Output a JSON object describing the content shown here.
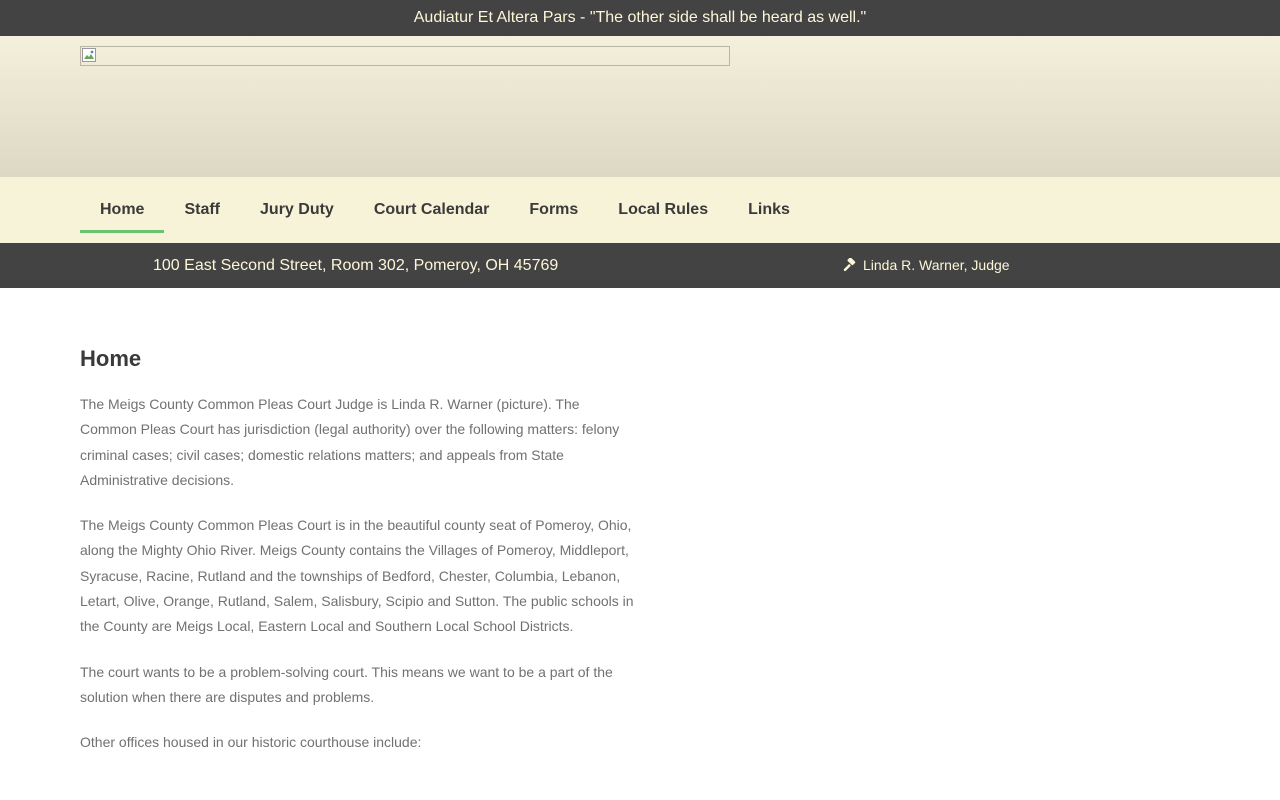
{
  "topbar": {
    "motto": "Audiatur Et Altera Pars - \"The other side shall be heard as well.\""
  },
  "nav": {
    "items": [
      {
        "label": "Home"
      },
      {
        "label": "Staff"
      },
      {
        "label": "Jury Duty"
      },
      {
        "label": "Court Calendar"
      },
      {
        "label": "Forms"
      },
      {
        "label": "Local Rules"
      },
      {
        "label": "Links"
      }
    ],
    "active": "Home"
  },
  "infobar": {
    "address": "100 East Second Street, Room 302, Pomeroy, OH 45769",
    "judge": "Linda R. Warner, Judge",
    "judge_icon": "gavel-icon"
  },
  "main": {
    "title": "Home",
    "paragraphs": [
      "The Meigs County Common Pleas Court Judge is Linda R. Warner (picture). The Common Pleas Court has jurisdiction (legal authority) over the following matters: felony criminal cases; civil cases; domestic relations matters; and appeals from State Administrative decisions.",
      "The Meigs County Common Pleas Court is in the beautiful county seat of Pomeroy, Ohio, along the Mighty Ohio River. Meigs County contains the Villages of Pomeroy, Middleport, Syracuse, Racine, Rutland and the townships of Bedford, Chester, Columbia, Lebanon, Letart, Olive, Orange, Rutland, Salem, Salisbury, Scipio and Sutton. The public schools in the County are Meigs Local, Eastern Local and Southern Local School Districts.",
      "The court wants to be a problem-solving court. This means we want to be a part of the solution when there are disputes and problems.",
      "Other offices housed in our historic courthouse include:"
    ]
  },
  "colors": {
    "dark_bar": "#434343",
    "cream_text": "#fdf6d8",
    "nav_bg": "#f7f3d9",
    "active_underline": "#6ac46f",
    "body_text": "#717171"
  }
}
